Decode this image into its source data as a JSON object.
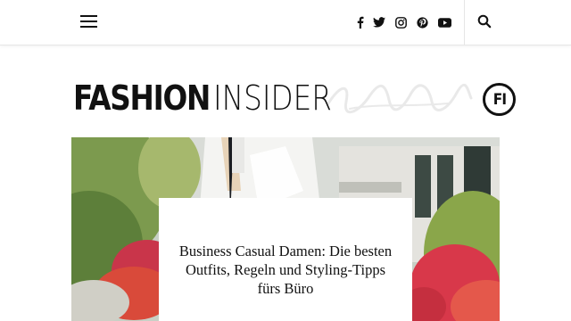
{
  "header": {
    "menu_icon": "hamburger-menu-icon",
    "social_icons": [
      "facebook-icon",
      "twitter-icon",
      "instagram-icon",
      "pinterest-icon",
      "youtube-icon"
    ],
    "search_icon": "search-icon"
  },
  "brand": {
    "logo_bold": "FASHION",
    "logo_light": "INSIDER",
    "badge": "FI"
  },
  "featured": {
    "title": "Business Casual Damen: Die besten Outfits, Regeln und Styling-Tipps fürs Büro"
  },
  "colors": {
    "text": "#111111",
    "border": "#e6e6e6",
    "background": "#ffffff"
  }
}
